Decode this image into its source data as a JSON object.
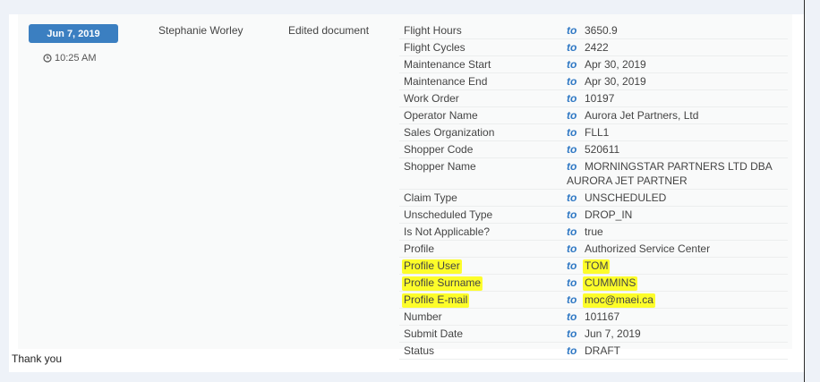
{
  "entry": {
    "date": "Jun 7, 2019",
    "time": "10:25 AM",
    "user": "Stephanie Worley",
    "action": "Edited document",
    "to_label": "to",
    "changes": [
      {
        "field": "Flight Hours",
        "value": "3650.9",
        "highlight": false
      },
      {
        "field": "Flight Cycles",
        "value": "2422",
        "highlight": false
      },
      {
        "field": "Maintenance Start",
        "value": "Apr 30, 2019",
        "highlight": false
      },
      {
        "field": "Maintenance End",
        "value": "Apr 30, 2019",
        "highlight": false
      },
      {
        "field": "Work Order",
        "value": "10197",
        "highlight": false
      },
      {
        "field": "Operator Name",
        "value": "Aurora Jet Partners, Ltd",
        "highlight": false
      },
      {
        "field": "Sales Organization",
        "value": "FLL1",
        "highlight": false
      },
      {
        "field": "Shopper Code",
        "value": "520611",
        "highlight": false
      },
      {
        "field": "Shopper Name",
        "value": "MORNINGSTAR PARTNERS LTD DBA",
        "value_cont": "AURORA JET PARTNER",
        "highlight": false
      },
      {
        "field": "Claim Type",
        "value": "UNSCHEDULED",
        "highlight": false
      },
      {
        "field": "Unscheduled Type",
        "value": "DROP_IN",
        "highlight": false
      },
      {
        "field": "Is Not Applicable?",
        "value": "true",
        "highlight": false
      },
      {
        "field": "Profile",
        "value": "Authorized Service Center",
        "highlight": false
      },
      {
        "field": "Profile User",
        "value": "TOM",
        "highlight": true
      },
      {
        "field": "Profile Surname",
        "value": "CUMMINS",
        "highlight": true
      },
      {
        "field": "Profile E-mail",
        "value": "moc@maei.ca",
        "highlight": true
      },
      {
        "field": "Number",
        "value": "101167",
        "highlight": false
      },
      {
        "field": "Submit Date",
        "value": "Jun 7, 2019",
        "highlight": false
      },
      {
        "field": "Status",
        "value": "DRAFT",
        "highlight": false
      }
    ]
  },
  "footer_text": "Thank you",
  "colors": {
    "badge": "#3b7fc1",
    "to_accent": "#2f78c4",
    "highlight": "#fdfd2a"
  },
  "icons": {
    "time": "clock-icon"
  }
}
